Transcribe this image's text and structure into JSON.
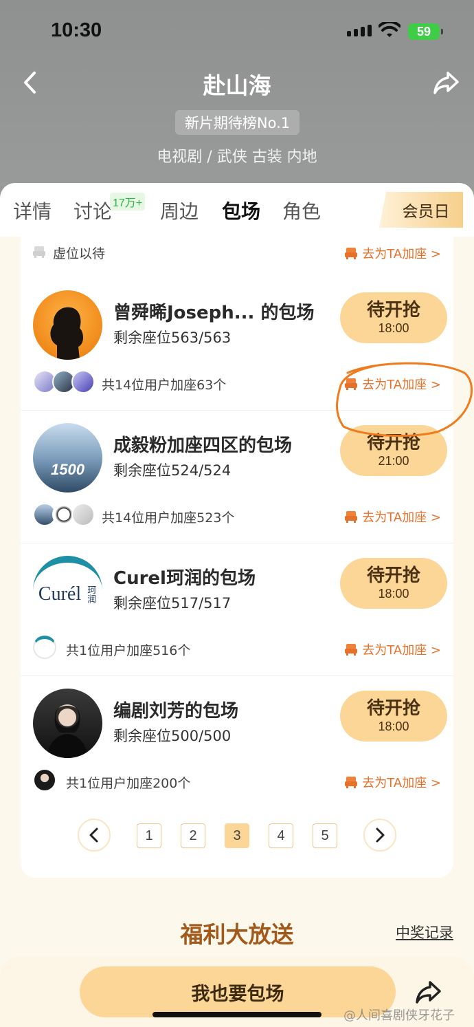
{
  "status_bar": {
    "time": "10:30",
    "battery": "59"
  },
  "header": {
    "title": "赴山海",
    "rank_badge": "新片期待榜No.1",
    "genre": "电视剧 / 武侠 古装 内地"
  },
  "tabs": [
    {
      "label": "详情",
      "active": false
    },
    {
      "label": "讨论",
      "active": false,
      "badge": "17万+"
    },
    {
      "label": "周边",
      "active": false
    },
    {
      "label": "包场",
      "active": true
    },
    {
      "label": "角色",
      "active": false
    }
  ],
  "member_day": "会员日",
  "top_row": {
    "vacancy": "虚位以待",
    "join": "去为TA加座 >"
  },
  "items": [
    {
      "title": "曾舜晞Joseph...  的包场",
      "seats": "剩余座位563/563",
      "button": "待开抢",
      "time": "18:00",
      "users": "共14位用户加座63个",
      "join": "去为TA加座 >"
    },
    {
      "title": "成毅粉加座四区的包场",
      "seats": "剩余座位524/524",
      "button": "待开抢",
      "time": "21:00",
      "users": "共14位用户加座523个",
      "join": "去为TA加座 >",
      "avatar_text": "1500"
    },
    {
      "title": "Curel珂润的包场",
      "seats": "剩余座位517/517",
      "button": "待开抢",
      "time": "18:00",
      "users": "共1位用户加座516个",
      "join": "去为TA加座 >",
      "avatar_text": "Curél",
      "avatar_text2": "珂润"
    },
    {
      "title": "编剧刘芳的包场",
      "seats": "剩余座位500/500",
      "button": "待开抢",
      "time": "18:00",
      "users": "共1位用户加座200个",
      "join": "去为TA加座 >"
    }
  ],
  "pagination": {
    "pages": [
      "1",
      "2",
      "3",
      "4",
      "5"
    ],
    "current": "3"
  },
  "welfare": {
    "title": "福利大放送",
    "winners_link": "中奖记录"
  },
  "bottom": {
    "charter_button": "我也要包场"
  },
  "watermark": "@人间喜剧侠牙花子",
  "colors": {
    "accent_button": "#fbd697",
    "link_orange": "#e5722b",
    "welfare_title": "#a25a1c",
    "annotation_circle": "#f07a1c"
  },
  "icons": [
    "back-arrow-icon",
    "share-icon",
    "signal-icon",
    "wifi-icon",
    "seat-icon",
    "chevron-left-icon",
    "chevron-right-icon"
  ]
}
